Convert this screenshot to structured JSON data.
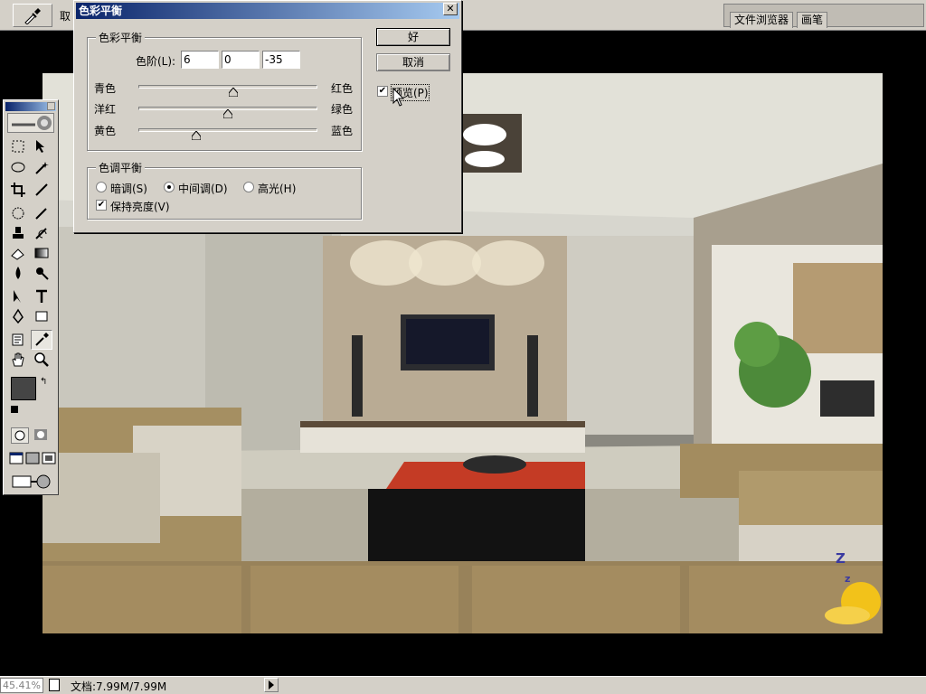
{
  "options_bar": {
    "label": "取",
    "palette_tabs": [
      "文件浏览器",
      "画笔"
    ]
  },
  "dialog": {
    "title": "色彩平衡",
    "close_glyph": "✕",
    "color_balance": {
      "legend": "色彩平衡",
      "levels_label": "色阶(L):",
      "levels": [
        "6",
        "0",
        "-35"
      ],
      "sliders": [
        {
          "left": "青色",
          "right": "红色",
          "value": 6
        },
        {
          "left": "洋红",
          "right": "绿色",
          "value": 0
        },
        {
          "left": "黄色",
          "right": "蓝色",
          "value": -35
        }
      ]
    },
    "tone_balance": {
      "legend": "色调平衡",
      "options": [
        "暗调(S)",
        "中间调(D)",
        "高光(H)"
      ],
      "selected": "中间调(D)",
      "preserve_luminosity": "保持亮度(V)",
      "preserve_checked": true
    },
    "ok_label": "好",
    "cancel_label": "取消",
    "preview_label": "预览(P)",
    "preview_checked": true
  },
  "canvas": {
    "overlay_text": "Z",
    "overlay_text_small": "z"
  },
  "status_bar": {
    "zoom": "45.41%",
    "doc_info": "文档:7.99M/7.99M"
  },
  "colors": {
    "accent_title": "#0a246a",
    "ui_face": "#d4d0c8"
  }
}
